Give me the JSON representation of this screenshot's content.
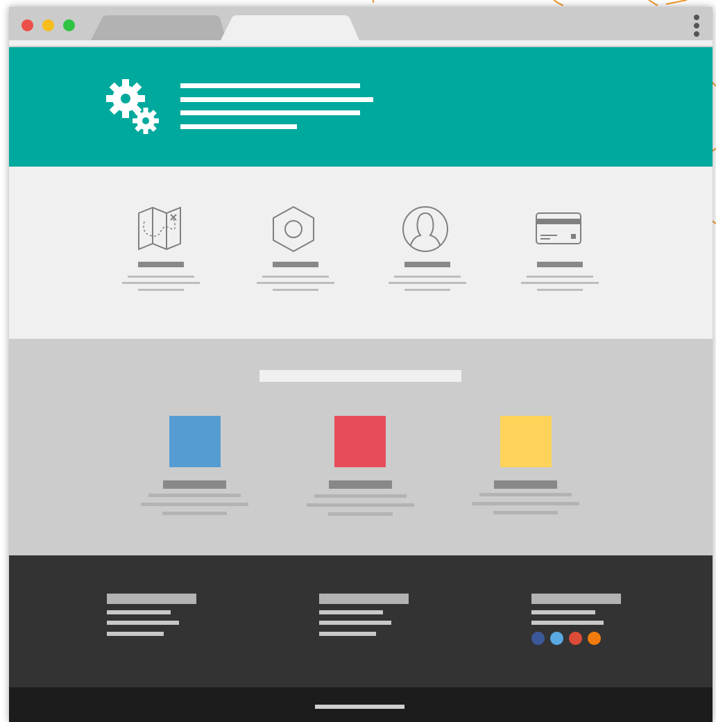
{
  "window": {
    "controls": [
      {
        "name": "close",
        "color": "#ec4f4a"
      },
      {
        "name": "minimize",
        "color": "#f6be1c"
      },
      {
        "name": "zoom",
        "color": "#31c343"
      }
    ],
    "tabs": [
      {
        "state": "inactive",
        "color": "#b2b2b2"
      },
      {
        "state": "active",
        "color": "#f0f0f0"
      }
    ],
    "menu_icon": "kebab-menu-icon"
  },
  "hero": {
    "background": "#00a99d",
    "icon": "gears-icon",
    "text_line_count": 4
  },
  "features": {
    "items": [
      {
        "icon": "map-icon"
      },
      {
        "icon": "hex-nut-icon"
      },
      {
        "icon": "user-icon"
      },
      {
        "icon": "credit-card-icon"
      }
    ]
  },
  "showcase": {
    "background": "#cccccc",
    "cards": [
      {
        "color": "#559cd3"
      },
      {
        "color": "#e74c5b"
      },
      {
        "color": "#fed35a"
      }
    ]
  },
  "footer": {
    "background": "#333333",
    "social_dots": [
      {
        "name": "facebook-dot",
        "color": "#3b5998"
      },
      {
        "name": "twitter-dot",
        "color": "#5aa9e3"
      },
      {
        "name": "googleplus-dot",
        "color": "#dd4b39"
      },
      {
        "name": "rss-dot",
        "color": "#f17c0d"
      }
    ]
  },
  "bottom_bar": {
    "background": "#1c1c1c"
  }
}
